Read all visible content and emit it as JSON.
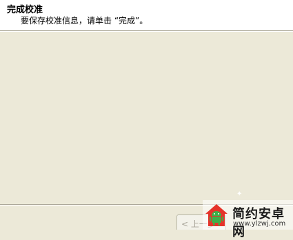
{
  "header": {
    "title": "完成校准",
    "description": "要保存校准信息，请单击 “完成”。"
  },
  "footer": {
    "back_label": "< 上一步"
  },
  "watermark": {
    "name": "简约安卓网",
    "url": "www.ylzwj.com",
    "logo_icon": "android-house-icon",
    "colors": {
      "logo_red": "#e5332a",
      "logo_green": "#3db04a"
    }
  }
}
